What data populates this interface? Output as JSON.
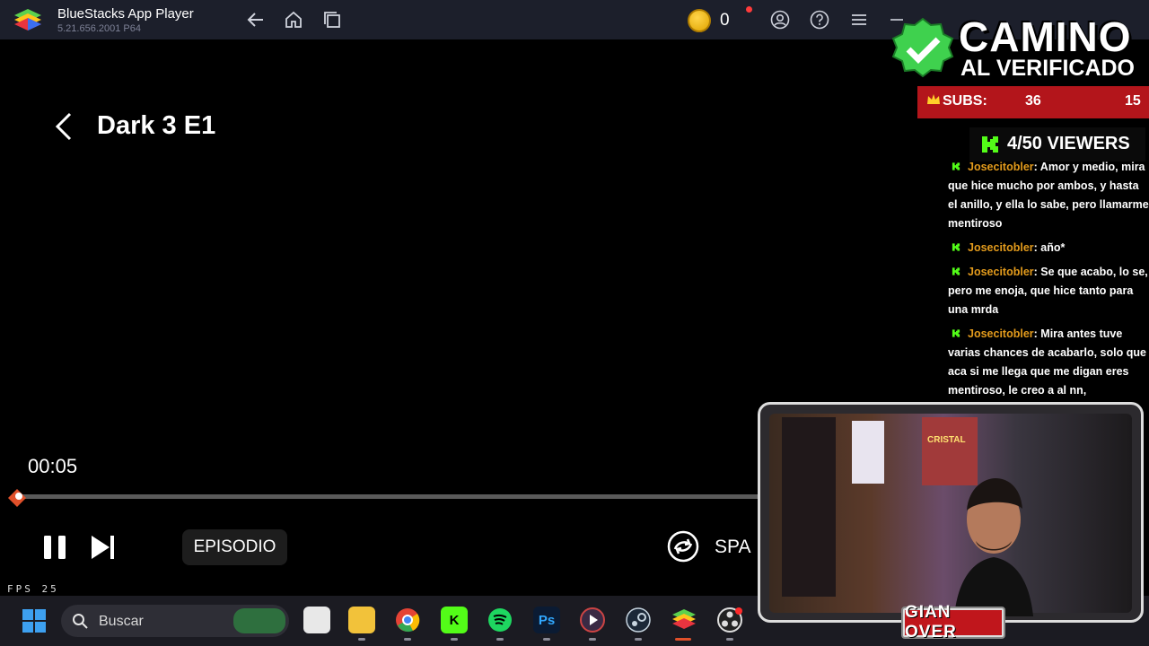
{
  "window": {
    "title": "BlueStacks App Player",
    "version": "5.21.656.2001 P64",
    "coins": "0"
  },
  "player": {
    "title": "Dark 3  E1",
    "timecode": "00:05",
    "progress_percent": 0.5,
    "episode_label": "EPISODIO",
    "speed_label": "SPA",
    "fps_label": "FPS",
    "fps_value": "25"
  },
  "taskbar": {
    "search_placeholder": "Buscar",
    "apps": [
      "windows-start",
      "file-explorer",
      "folder",
      "chrome",
      "kick",
      "spotify",
      "photoshop",
      "media-player",
      "steam",
      "bluestacks",
      "obs"
    ]
  },
  "overlay": {
    "title_line1": "CAMINO",
    "title_line2": "AL VERIFICADO",
    "subs_label": "SUBS:",
    "subs_value": "36",
    "subs_goal": "15",
    "viewers": "4/50 VIEWERS",
    "chat": [
      {
        "user": "Josecitobler",
        "text": ": Amor y medio, mira que hice mucho por ambos, y hasta el anillo, y ella lo sabe, pero llamarme mentiroso"
      },
      {
        "user": "Josecitobler",
        "text": ": año*"
      },
      {
        "user": "Josecitobler",
        "text": ": Se que acabo, lo se, pero me enoja, que hice tanto para una mrda"
      },
      {
        "user": "Josecitobler",
        "text": ": Mira antes tuve varias chances de acabarlo, solo que aca si me llega que me digan eres mentiroso, le creo a al nn,"
      }
    ],
    "cam_poster": "CRISTAL",
    "streamer_name": "GIAN OVER"
  },
  "colors": {
    "accent_orange": "#e0502a",
    "kick_green": "#53fc18",
    "subs_red": "#b3151b",
    "chat_user": "#e39b1c"
  }
}
